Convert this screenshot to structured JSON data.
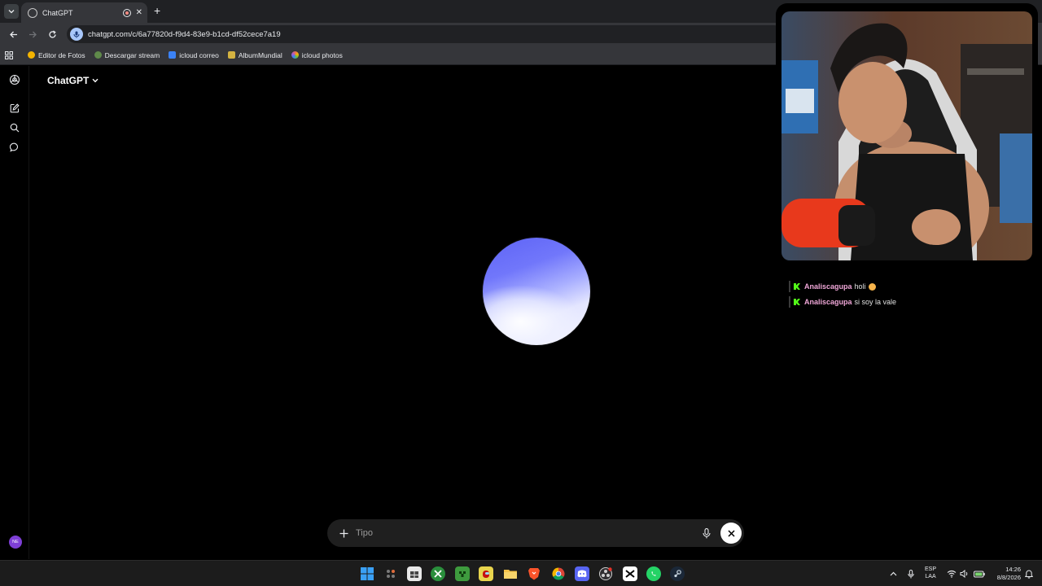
{
  "browser": {
    "tab": {
      "title": "ChatGPT",
      "favicon": "openai-logo-icon",
      "status_icon": "recording-icon"
    },
    "url": "chatgpt.com/c/6a77820d-f9d4-83e9-b1cd-df52cece7a19",
    "bookmarks": [
      {
        "label": "Editor de Fotos",
        "color": "#f4b400"
      },
      {
        "label": "Descargar stream",
        "color": "#5f8a4a"
      },
      {
        "label": "icloud correo",
        "color": "#3b82f6"
      },
      {
        "label": "AlbumMundial",
        "color": "#d4b341"
      },
      {
        "label": "icloud photos",
        "color": "#e86b5a"
      }
    ]
  },
  "app": {
    "model_picker": {
      "label": "ChatGPT",
      "icon": "chevron-down-icon"
    },
    "sidebar": {
      "icons": [
        "openai-logo-icon",
        "new-chat-icon",
        "search-icon",
        "chats-icon"
      ],
      "avatar_initials": "NE",
      "avatar_color": "#7e3fd6"
    },
    "composer": {
      "placeholder": "Tipo"
    },
    "orb_colors": {
      "top": "#5d63f5",
      "bottom": "#f5f5ff"
    }
  },
  "stream_chat": {
    "messages": [
      {
        "user": "Analiscagupa",
        "text": "holi",
        "emoji": "face-emoji"
      },
      {
        "user": "Analiscagupa",
        "text": "si soy la vale",
        "emoji": ""
      }
    ],
    "user_color": "#f0a7d8",
    "badge_color": "#53fc18"
  },
  "taskbar": {
    "apps": [
      "windows-start-icon",
      "widgets-icon",
      "store-icon",
      "xbox-icon",
      "minecraft-icon",
      "among-us-icon",
      "file-explorer-icon",
      "brave-icon",
      "chrome-icon",
      "discord-icon",
      "obs-icon",
      "capcut-icon",
      "whatsapp-icon",
      "steam-icon"
    ],
    "language": {
      "line1": "ESP",
      "line2": "LAA"
    },
    "time": "14:26",
    "date": "8/8/2026"
  }
}
